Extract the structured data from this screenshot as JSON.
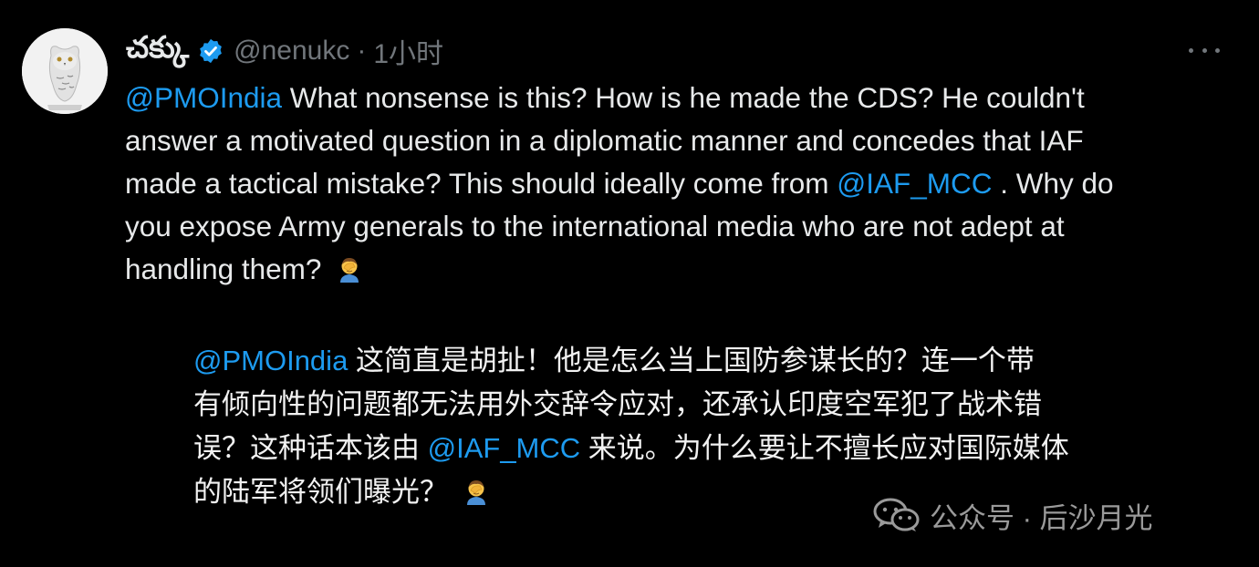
{
  "author": {
    "display_name": "చక్కు",
    "handle": "@nenukc",
    "separator": "·",
    "time": "1小时"
  },
  "tweet": {
    "line1": {
      "mention": "@PMOIndia",
      "text": " What nonsense is this? How is he made the CDS? He couldn't"
    },
    "line2": {
      "text": "answer a motivated question in a diplomatic manner and concedes that IAF"
    },
    "line3": {
      "text_before": "made a tactical mistake? This should ideally come from ",
      "mention": "@IAF_MCC",
      "text_after": " . Why do"
    },
    "line4": {
      "text": "you expose Army generals to the international media who are not adept at"
    },
    "line5": {
      "text": "handling them? "
    }
  },
  "translation": {
    "line1": {
      "mention": "@PMOIndia",
      "text": " 这简直是胡扯！他是怎么当上国防参谋长的？连一个带"
    },
    "line2": {
      "text": "有倾向性的问题都无法用外交辞令应对，还承认印度空军犯了战术错"
    },
    "line3": {
      "text_before": "误？这种话本该由 ",
      "mention": "@IAF_MCC",
      "text_after": " 来说。为什么要让不擅长应对国际媒体"
    },
    "line4": {
      "text": "的陆军将领们曝光？ "
    }
  },
  "watermark": {
    "text": "公众号 · 后沙月光"
  },
  "icons": {
    "verified": "verified-badge-icon",
    "more": "more-options-icon",
    "emoji": "facepalm-emoji-icon",
    "watermark_logo": "wechat-logo-icon"
  },
  "colors": {
    "background": "#000000",
    "text": "#e7e9ea",
    "mention": "#1d9bf0",
    "muted": "#71767b",
    "verified": "#1d9bf0"
  }
}
